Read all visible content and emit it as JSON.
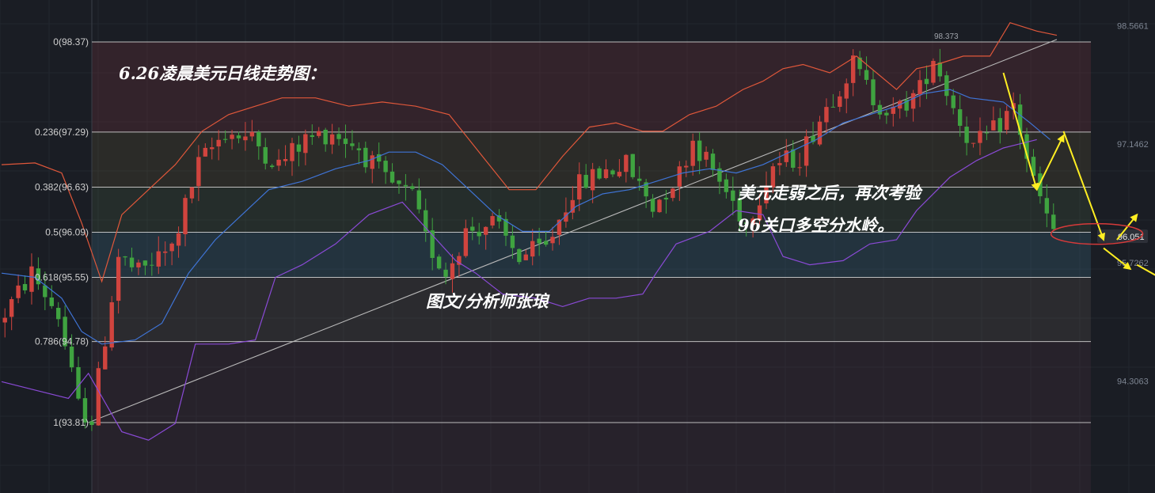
{
  "chart_data": {
    "type": "candlestick",
    "title": "6.26凌晨美元日线走势图：",
    "fib_levels": [
      {
        "label": "0(98.37)",
        "ratio": 0,
        "price": 98.37
      },
      {
        "label": "0.236(97.29)",
        "ratio": 0.236,
        "price": 97.29
      },
      {
        "label": "0.382(96.63)",
        "ratio": 0.382,
        "price": 96.63
      },
      {
        "label": "0.5(96.09)",
        "ratio": 0.5,
        "price": 96.09
      },
      {
        "label": "0.618(95.55)",
        "ratio": 0.618,
        "price": 95.55
      },
      {
        "label": "0.786(94.78)",
        "ratio": 0.786,
        "price": 94.78
      },
      {
        "label": "1(93.81)",
        "ratio": 1,
        "price": 93.81
      }
    ],
    "right_axis_ticks": [
      "98.5661",
      "97.1462",
      "95.7262",
      "94.3063"
    ],
    "current_price": "96.051",
    "peak_label": "98.373",
    "ylim": [
      92.9,
      98.75
    ],
    "annotation_main": [
      "美元走弱之后，再次考验",
      "96关口多空分水岭。"
    ],
    "annotation_author": "图文/分析师张琅",
    "colors": {
      "up": "#d0443e",
      "down": "#3fa340",
      "bb_upper": "#e0573a",
      "bb_mid": "#3f74d6",
      "bb_lower": "#8a4ad6",
      "trendline": "#b9b9b9",
      "arrow": "#ffee22",
      "circle": "#d63a3a"
    },
    "bb_upper": [
      [
        0,
        96.9
      ],
      [
        5,
        96.92
      ],
      [
        9,
        96.8
      ],
      [
        12,
        96.2
      ],
      [
        15,
        95.5
      ],
      [
        18,
        96.3
      ],
      [
        22,
        96.6
      ],
      [
        26,
        96.9
      ],
      [
        30,
        97.3
      ],
      [
        34,
        97.5
      ],
      [
        38,
        97.6
      ],
      [
        42,
        97.7
      ],
      [
        47,
        97.7
      ],
      [
        52,
        97.6
      ],
      [
        57,
        97.65
      ],
      [
        62,
        97.6
      ],
      [
        67,
        97.5
      ],
      [
        72,
        97.0
      ],
      [
        76,
        96.6
      ],
      [
        80,
        96.6
      ],
      [
        84,
        97.0
      ],
      [
        88,
        97.35
      ],
      [
        92,
        97.4
      ],
      [
        96,
        97.3
      ],
      [
        99,
        97.3
      ],
      [
        103,
        97.5
      ],
      [
        107,
        97.6
      ],
      [
        111,
        97.8
      ],
      [
        114,
        97.9
      ],
      [
        117,
        98.05
      ],
      [
        120,
        98.1
      ],
      [
        124,
        98.0
      ],
      [
        128,
        98.2
      ],
      [
        131,
        98.0
      ],
      [
        134,
        97.8
      ],
      [
        137,
        98.05
      ],
      [
        140,
        98.1
      ],
      [
        144,
        98.2
      ],
      [
        148,
        98.2
      ],
      [
        151,
        98.6
      ],
      [
        155,
        98.5
      ],
      [
        158,
        98.45
      ]
    ],
    "bb_mid": [
      [
        0,
        95.6
      ],
      [
        5,
        95.55
      ],
      [
        9,
        95.3
      ],
      [
        12,
        94.9
      ],
      [
        15,
        94.75
      ],
      [
        20,
        94.8
      ],
      [
        24,
        95.0
      ],
      [
        28,
        95.6
      ],
      [
        32,
        96.0
      ],
      [
        36,
        96.3
      ],
      [
        40,
        96.6
      ],
      [
        45,
        96.7
      ],
      [
        50,
        96.85
      ],
      [
        55,
        96.95
      ],
      [
        58,
        97.05
      ],
      [
        62,
        97.05
      ],
      [
        66,
        96.9
      ],
      [
        70,
        96.6
      ],
      [
        74,
        96.3
      ],
      [
        78,
        96.1
      ],
      [
        82,
        96.1
      ],
      [
        86,
        96.4
      ],
      [
        90,
        96.55
      ],
      [
        94,
        96.6
      ],
      [
        98,
        96.7
      ],
      [
        102,
        96.8
      ],
      [
        106,
        96.85
      ],
      [
        110,
        96.8
      ],
      [
        114,
        96.9
      ],
      [
        118,
        97.05
      ],
      [
        122,
        97.2
      ],
      [
        126,
        97.4
      ],
      [
        130,
        97.5
      ],
      [
        134,
        97.6
      ],
      [
        138,
        97.75
      ],
      [
        142,
        97.8
      ],
      [
        145,
        97.7
      ],
      [
        150,
        97.65
      ],
      [
        154,
        97.4
      ],
      [
        157,
        97.2
      ]
    ],
    "bb_lower": [
      [
        0,
        94.3
      ],
      [
        5,
        94.2
      ],
      [
        10,
        94.1
      ],
      [
        13,
        94.4
      ],
      [
        18,
        93.7
      ],
      [
        22,
        93.6
      ],
      [
        26,
        93.8
      ],
      [
        29,
        94.75
      ],
      [
        34,
        94.75
      ],
      [
        38,
        94.8
      ],
      [
        41,
        95.55
      ],
      [
        45,
        95.7
      ],
      [
        50,
        95.95
      ],
      [
        55,
        96.3
      ],
      [
        60,
        96.45
      ],
      [
        64,
        96.1
      ],
      [
        68,
        95.75
      ],
      [
        71,
        95.6
      ],
      [
        75,
        95.35
      ],
      [
        80,
        95.3
      ],
      [
        84,
        95.2
      ],
      [
        88,
        95.3
      ],
      [
        92,
        95.3
      ],
      [
        96,
        95.35
      ],
      [
        98,
        95.6
      ],
      [
        101,
        95.95
      ],
      [
        106,
        96.1
      ],
      [
        110,
        96.35
      ],
      [
        114,
        96.3
      ],
      [
        117,
        95.8
      ],
      [
        121,
        95.7
      ],
      [
        126,
        95.75
      ],
      [
        130,
        95.95
      ],
      [
        134,
        96.0
      ],
      [
        137,
        96.35
      ],
      [
        142,
        96.75
      ],
      [
        146,
        96.95
      ],
      [
        150,
        97.1
      ],
      [
        155,
        97.2
      ]
    ],
    "trendline": [
      [
        13,
        93.81
      ],
      [
        158,
        98.4
      ]
    ],
    "ohlc_seed": {
      "count": 158,
      "waypoints": [
        [
          0,
          95.0
        ],
        [
          5,
          95.6
        ],
        [
          9,
          95.1
        ],
        [
          12,
          94.0
        ],
        [
          14,
          93.85
        ],
        [
          18,
          95.8
        ],
        [
          21,
          95.6
        ],
        [
          26,
          95.9
        ],
        [
          30,
          96.9
        ],
        [
          34,
          97.3
        ],
        [
          38,
          97.2
        ],
        [
          42,
          96.9
        ],
        [
          46,
          97.2
        ],
        [
          50,
          97.3
        ],
        [
          54,
          97.1
        ],
        [
          58,
          96.7
        ],
        [
          62,
          96.5
        ],
        [
          64,
          96.0
        ],
        [
          67,
          95.6
        ],
        [
          70,
          96.1
        ],
        [
          74,
          96.2
        ],
        [
          78,
          95.8
        ],
        [
          82,
          95.9
        ],
        [
          86,
          96.6
        ],
        [
          90,
          96.8
        ],
        [
          94,
          96.9
        ],
        [
          98,
          96.4
        ],
        [
          102,
          96.8
        ],
        [
          104,
          97.2
        ],
        [
          108,
          96.7
        ],
        [
          112,
          96.2
        ],
        [
          116,
          96.9
        ],
        [
          120,
          97.0
        ],
        [
          124,
          97.6
        ],
        [
          128,
          98.1
        ],
        [
          131,
          97.7
        ],
        [
          134,
          97.5
        ],
        [
          138,
          97.8
        ],
        [
          140,
          98.2
        ],
        [
          143,
          97.6
        ],
        [
          146,
          97.1
        ],
        [
          149,
          97.3
        ],
        [
          152,
          97.6
        ],
        [
          155,
          96.7
        ],
        [
          158,
          96.05
        ]
      ]
    }
  }
}
